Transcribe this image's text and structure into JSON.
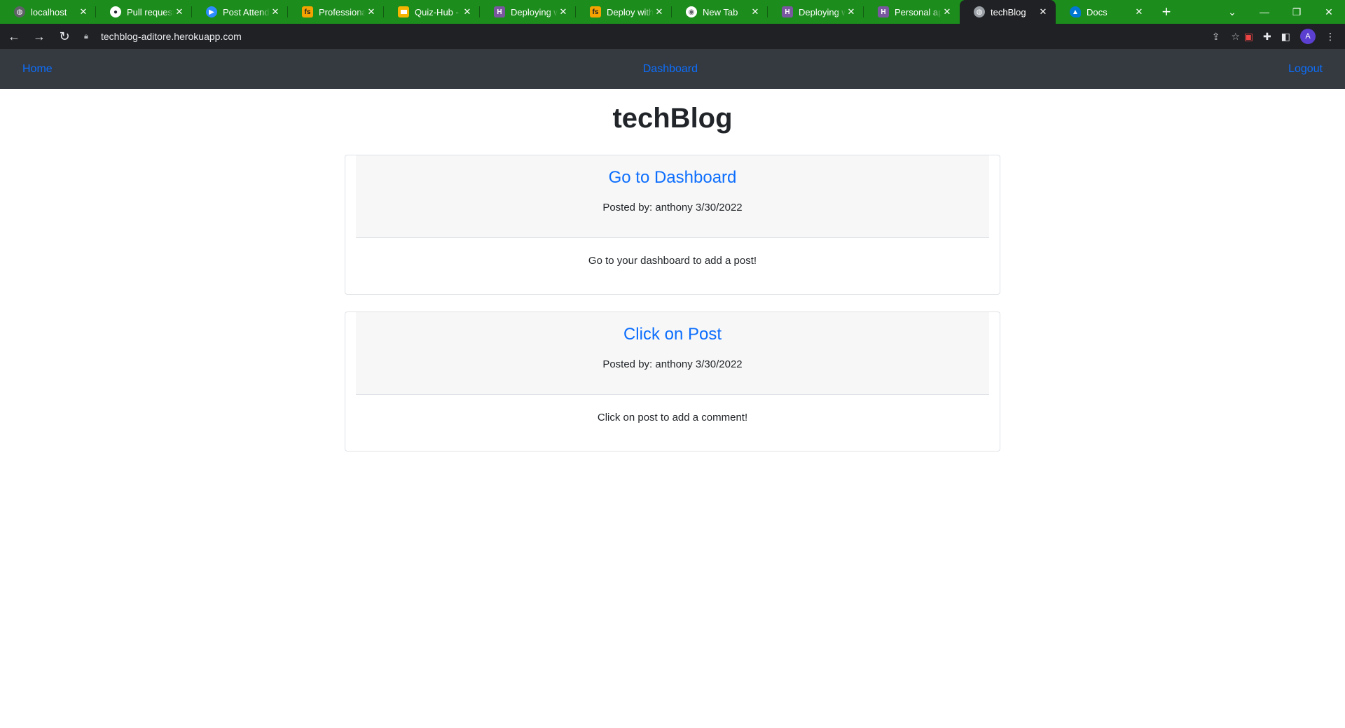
{
  "browser": {
    "tabs": [
      {
        "label": "localhost",
        "icon": "globe-icon",
        "color": "#5f6368"
      },
      {
        "label": "Pull requests",
        "icon": "github-icon",
        "color": "#24292f"
      },
      {
        "label": "Post Attendee",
        "icon": "zoom-icon",
        "color": "#2d8cff"
      },
      {
        "label": "Professional F",
        "icon": "fs-icon",
        "color": "#f5a300"
      },
      {
        "label": "Quiz-Hub - G",
        "icon": "slides-icon",
        "color": "#f4b400"
      },
      {
        "label": "Deploying wit",
        "icon": "heroku-icon",
        "color": "#79589f"
      },
      {
        "label": "Deploy with H",
        "icon": "fs-icon",
        "color": "#f5a300"
      },
      {
        "label": "New Tab",
        "icon": "chrome-icon",
        "color": "#5f6368"
      },
      {
        "label": "Deploying wit",
        "icon": "heroku-icon",
        "color": "#79589f"
      },
      {
        "label": "Personal apps",
        "icon": "heroku-icon",
        "color": "#79589f"
      },
      {
        "label": "techBlog",
        "icon": "globe-icon",
        "color": "#5f6368",
        "active": true
      },
      {
        "label": "Docs",
        "icon": "docs-icon",
        "color": "#0078d4"
      }
    ],
    "url": "techblog-aditore.herokuapp.com",
    "profile_initial": "A"
  },
  "nav": {
    "home": "Home",
    "dashboard": "Dashboard",
    "logout": "Logout"
  },
  "site_title": "techBlog",
  "posts": [
    {
      "title": "Go to Dashboard",
      "meta": "Posted by: anthony 3/30/2022",
      "body": "Go to your dashboard to add a post!"
    },
    {
      "title": "Click on Post",
      "meta": "Posted by: anthony 3/30/2022",
      "body": "Click on post to add a comment!"
    }
  ],
  "colors": {
    "tabstrip": "#1c8c1c",
    "navbar": "#343a40",
    "link": "#0d6efd"
  }
}
